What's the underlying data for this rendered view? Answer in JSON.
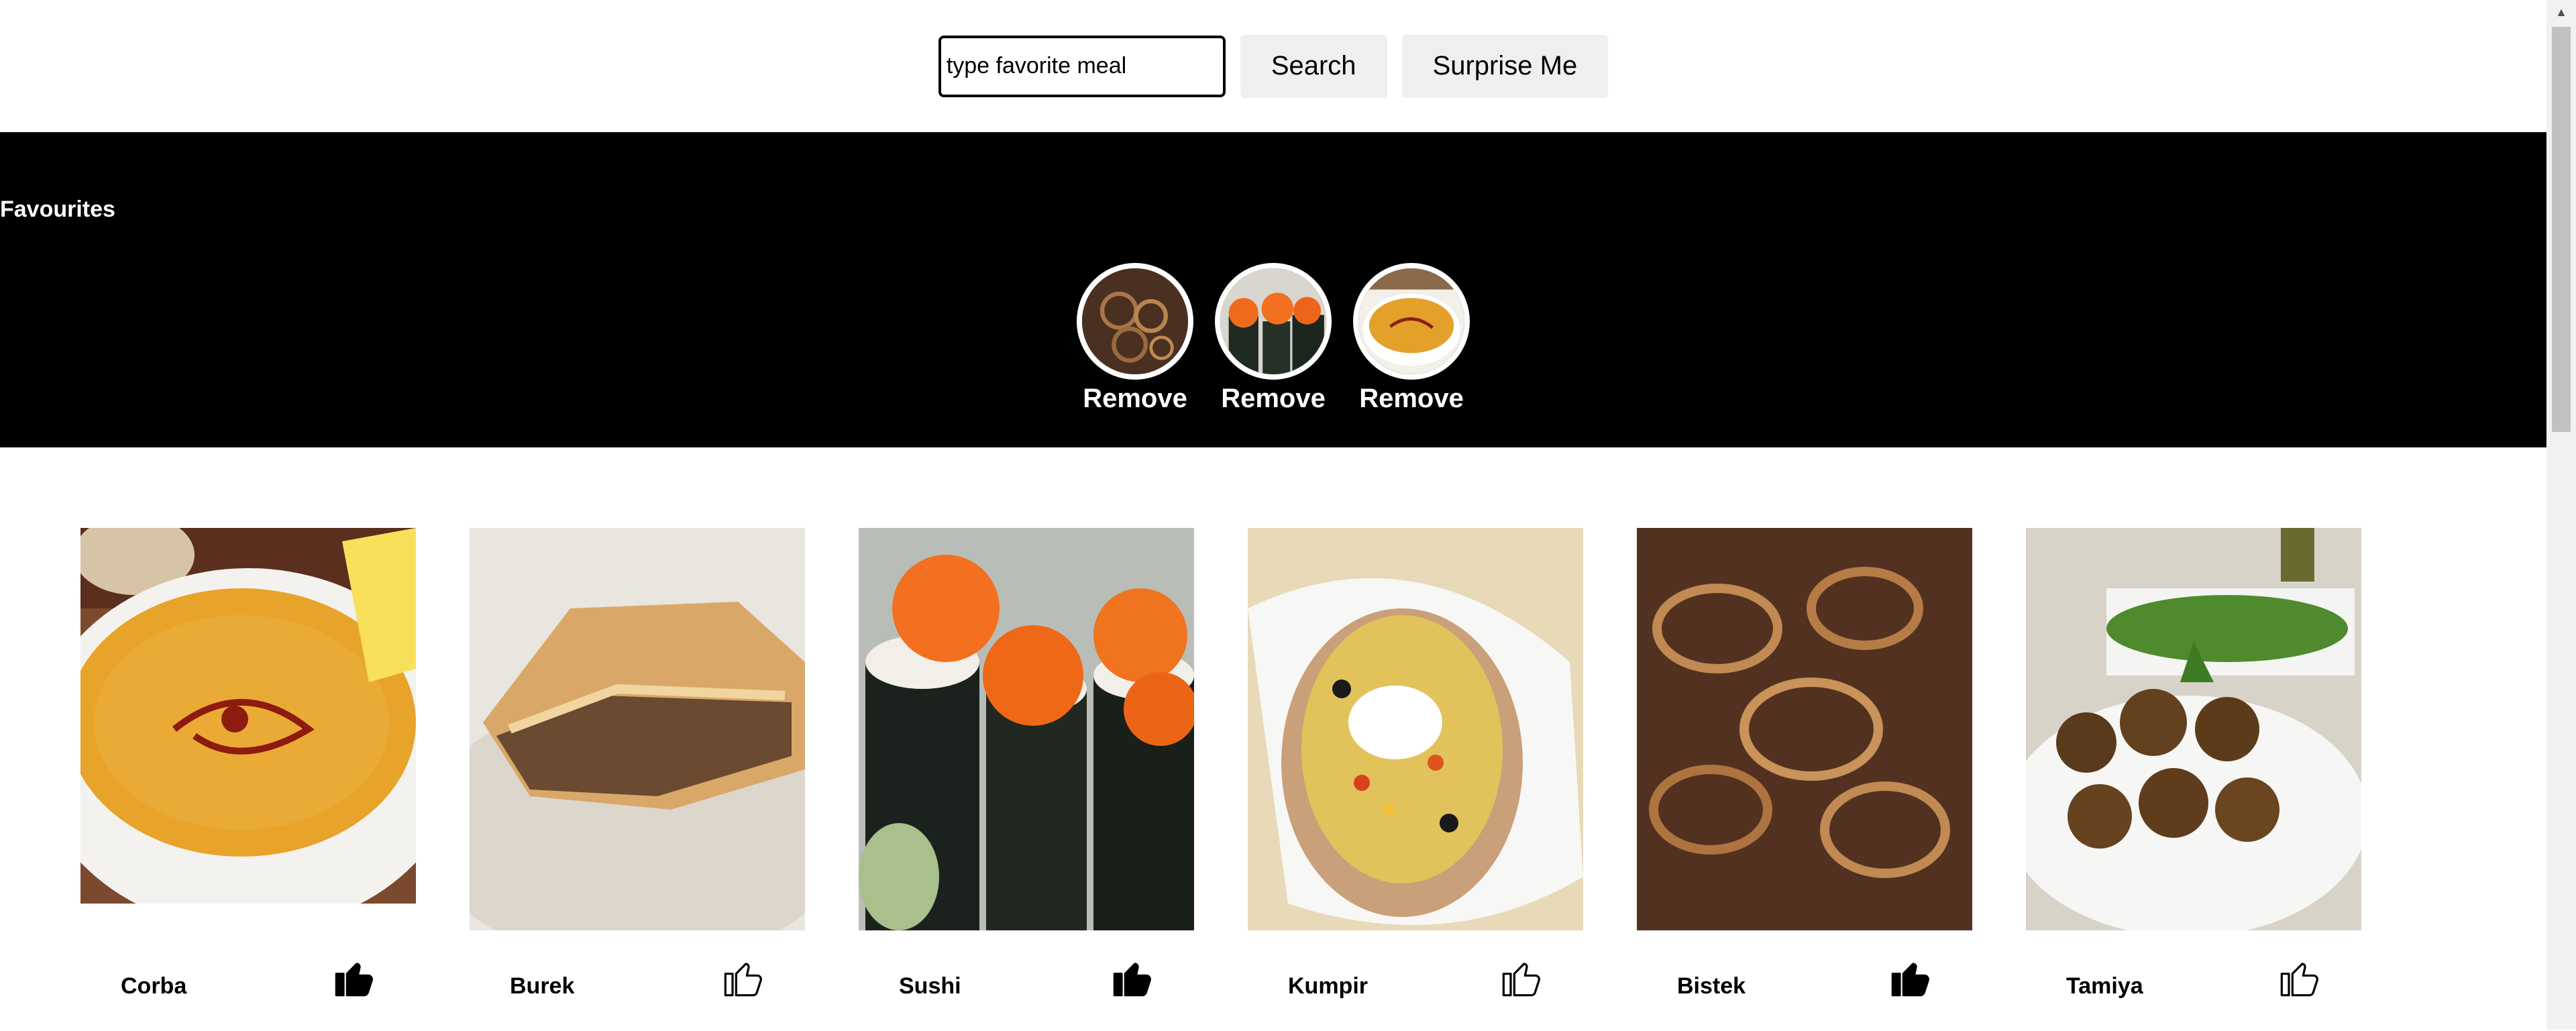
{
  "search": {
    "placeholder": "type favorite meal",
    "button_label": "Search",
    "random_label": "Surprise Me"
  },
  "favourites": {
    "title": "Favourites",
    "items": [
      {
        "image": "onion-steak",
        "remove_label": "Remove"
      },
      {
        "image": "sushi-roe",
        "remove_label": "Remove"
      },
      {
        "image": "lentil-soup",
        "remove_label": "Remove"
      }
    ]
  },
  "meals": [
    {
      "name": "Corba",
      "image": "lentil-soup",
      "liked": true
    },
    {
      "name": "Burek",
      "image": "meat-pastry",
      "liked": false
    },
    {
      "name": "Sushi",
      "image": "sushi-roe",
      "liked": true
    },
    {
      "name": "Kumpir",
      "image": "stuffed-potato",
      "liked": false
    },
    {
      "name": "Bistek",
      "image": "onion-steak",
      "liked": true
    },
    {
      "name": "Tamiya",
      "image": "falafel-plate",
      "liked": false
    }
  ],
  "icons": {
    "like": "thumbs-up-icon"
  },
  "colors": {
    "favourites_bg": "#000000",
    "button_bg": "#efefef"
  }
}
